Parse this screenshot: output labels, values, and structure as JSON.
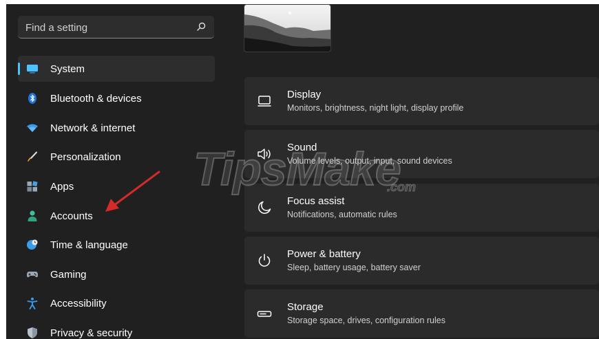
{
  "search": {
    "placeholder": "Find a setting",
    "icon": "search-icon"
  },
  "sidebar": {
    "items": [
      {
        "label": "System",
        "icon": "monitor-icon",
        "selected": true
      },
      {
        "label": "Bluetooth & devices",
        "icon": "bluetooth-icon"
      },
      {
        "label": "Network & internet",
        "icon": "wifi-icon"
      },
      {
        "label": "Personalization",
        "icon": "brush-icon"
      },
      {
        "label": "Apps",
        "icon": "apps-icon"
      },
      {
        "label": "Accounts",
        "icon": "person-icon"
      },
      {
        "label": "Time & language",
        "icon": "globe-clock-icon"
      },
      {
        "label": "Gaming",
        "icon": "gamepad-icon"
      },
      {
        "label": "Accessibility",
        "icon": "accessibility-icon"
      },
      {
        "label": "Privacy & security",
        "icon": "shield-icon"
      }
    ]
  },
  "main": {
    "cards": [
      {
        "title": "Display",
        "subtitle": "Monitors, brightness, night light, display profile",
        "icon": "display-icon"
      },
      {
        "title": "Sound",
        "subtitle": "Volume levels, output, input, sound devices",
        "icon": "speaker-icon"
      },
      {
        "title": "Focus assist",
        "subtitle": "Notifications, automatic rules",
        "icon": "moon-icon"
      },
      {
        "title": "Power & battery",
        "subtitle": "Sleep, battery usage, battery saver",
        "icon": "power-icon"
      },
      {
        "title": "Storage",
        "subtitle": "Storage space, drives, configuration rules",
        "icon": "storage-icon"
      }
    ]
  },
  "watermark": {
    "text": "TipsMake",
    "domain": ".com"
  },
  "colors": {
    "window_bg": "#202020",
    "card_bg": "#2b2b2b",
    "selected_bg": "#2d2d2d",
    "accent": "#4cc2ff",
    "arrow": "#d42a2a"
  }
}
